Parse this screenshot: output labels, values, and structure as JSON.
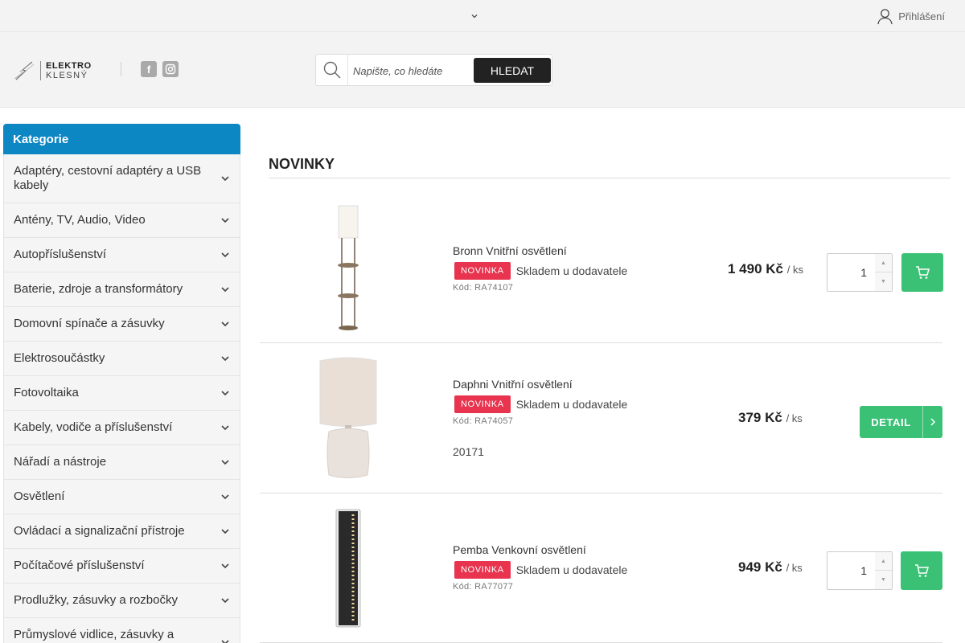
{
  "topbar": {
    "login_label": "Přihlášení"
  },
  "header": {
    "logo": {
      "line1": "ELEKTRO",
      "line2": "KLESNÝ"
    },
    "social": {
      "facebook": "f"
    },
    "search": {
      "placeholder": "Napište, co hledáte",
      "button_label": "HLEDAT"
    }
  },
  "sidebar": {
    "heading": "Kategorie",
    "items": [
      {
        "label": "Adaptéry, cestovní adaptéry a USB kabely"
      },
      {
        "label": "Antény, TV, Audio, Video"
      },
      {
        "label": "Autopříslušenství"
      },
      {
        "label": "Baterie, zdroje a transformátory"
      },
      {
        "label": "Domovní spínače a zásuvky"
      },
      {
        "label": "Elektrosoučástky"
      },
      {
        "label": "Fotovoltaika"
      },
      {
        "label": "Kabely, vodiče a příslušenství"
      },
      {
        "label": "Nářadí a nástroje"
      },
      {
        "label": "Osvětlení"
      },
      {
        "label": "Ovládací a signalizační přístroje"
      },
      {
        "label": "Počítačové příslušenství"
      },
      {
        "label": "Prodlužky, zásuvky a rozbočky"
      },
      {
        "label": "Průmyslové vidlice, zásuvky a kabely"
      }
    ]
  },
  "main": {
    "section_title": "NOVINKY",
    "products": [
      {
        "name": "Bronn Vnitřní osvětlení",
        "badge": "NOVINKA",
        "stock": "Skladem u dodavatele",
        "code": "Kód: RA74107",
        "price": "1 490 Kč",
        "unit": "/ ks",
        "qty": "1",
        "action": "cart"
      },
      {
        "name": "Daphni Vnitřní osvětlení",
        "badge": "NOVINKA",
        "stock": "Skladem u dodavatele",
        "code": "Kód: RA74057",
        "extra": "20171",
        "price": "379 Kč",
        "unit": "/ ks",
        "detail_label": "DETAIL",
        "action": "detail"
      },
      {
        "name": "Pemba Venkovní osvětlení",
        "badge": "NOVINKA",
        "stock": "Skladem u dodavatele",
        "code": "Kód: RA77077",
        "price": "949 Kč",
        "unit": "/ ks",
        "qty": "1",
        "action": "cart"
      }
    ]
  }
}
